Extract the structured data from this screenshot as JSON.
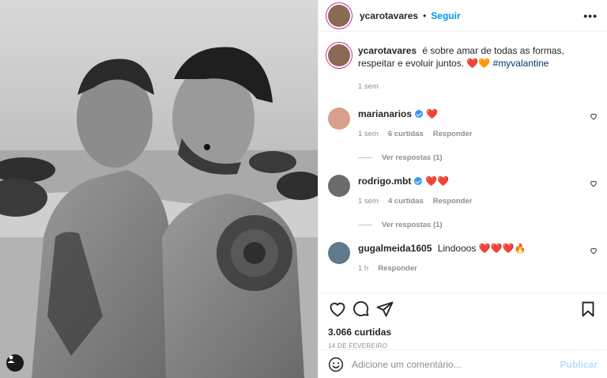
{
  "post": {
    "author": "ycarotavares",
    "follow_label": "Seguir",
    "separator": "•",
    "more_label": "•••",
    "caption": {
      "text": "é sobre amar de todas as formas, respeitar e evoluir juntos. ❤️🧡",
      "hashtag": "#myvalantine",
      "time": "1 sem"
    },
    "comments": [
      {
        "username": "marianarios",
        "verified": true,
        "text": "❤️",
        "time": "1 sem",
        "likes": "6 curtidas",
        "reply": "Responder",
        "view_replies": "Ver respostas (1)"
      },
      {
        "username": "rodrigo.mbt",
        "verified": true,
        "text": "❤️❤️",
        "time": "1 sem",
        "likes": "4 curtidas",
        "reply": "Responder",
        "view_replies": "Ver respostas (1)"
      },
      {
        "username": "gugalmeida1605",
        "verified": false,
        "text": "Lindooos ❤️❤️❤️🔥",
        "time": "1 h",
        "reply": "Responder"
      }
    ],
    "likes_count": "3.066 curtidas",
    "date": "14 DE FEVEREIRO",
    "add_comment_placeholder": "Adicione um comentário...",
    "publish_label": "Publicar"
  },
  "icons": {
    "like": "heart-icon",
    "comment": "comment-icon",
    "share": "paper-plane-icon",
    "save": "bookmark-icon",
    "emoji": "smiley-icon",
    "tag": "user-tag-icon"
  },
  "colors": {
    "accent": "#0095f6",
    "hashtag": "#00376b",
    "muted": "#8e8e8e",
    "publish_disabled": "#b2dffc",
    "verified": "#3897f0"
  }
}
